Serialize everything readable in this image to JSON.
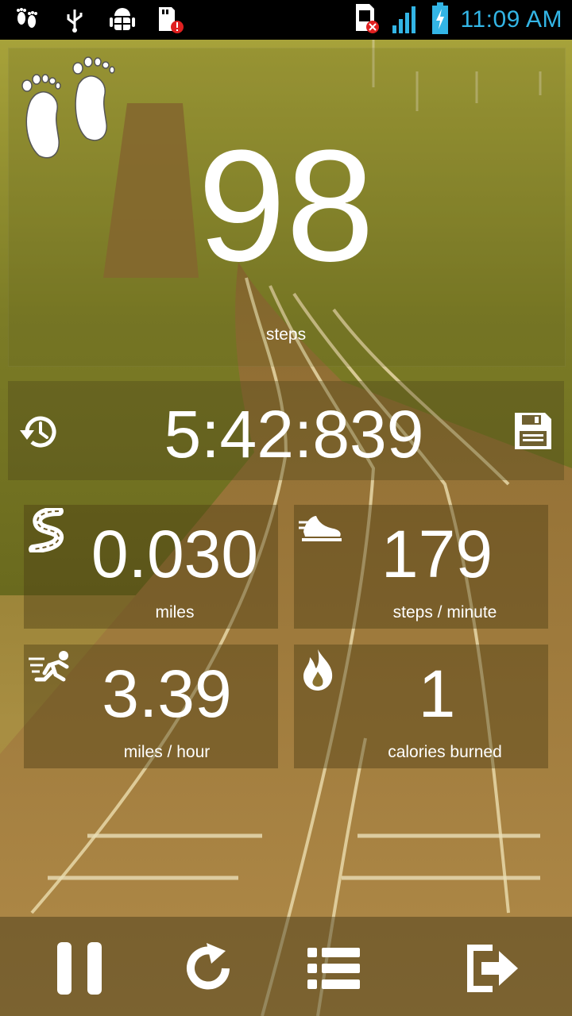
{
  "status_bar": {
    "time": "11:09 AM",
    "left_icons": [
      "footprints-icon",
      "usb-icon",
      "android-debug-icon",
      "sd-card-alert-icon"
    ],
    "right_icons": [
      "no-sim-icon",
      "signal-icon",
      "battery-charging-icon"
    ],
    "accent_color": "#33b5e5"
  },
  "steps": {
    "value": "98",
    "label": "steps",
    "icon": "footprints-icon"
  },
  "timer": {
    "value": "5:42:839",
    "left_icon": "history-icon",
    "right_icon": "save-icon"
  },
  "stats": [
    {
      "value": "0.030",
      "label": "miles",
      "icon": "road-icon"
    },
    {
      "value": "179",
      "label": "steps / minute",
      "icon": "shoe-icon"
    },
    {
      "value": "3.39",
      "label": "miles / hour",
      "icon": "runner-icon"
    },
    {
      "value": "1",
      "label": "calories burned",
      "icon": "flame-icon"
    }
  ],
  "bottom_bar": {
    "buttons": [
      "pause-icon",
      "reset-icon",
      "list-icon",
      "exit-icon"
    ]
  }
}
